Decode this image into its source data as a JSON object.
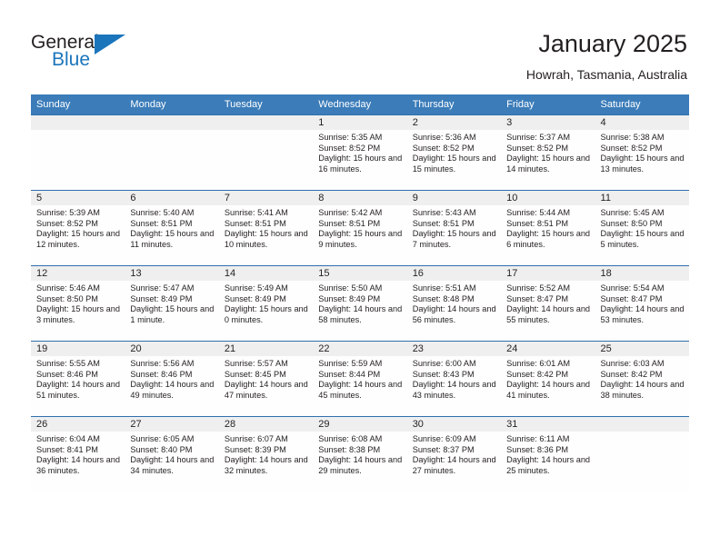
{
  "brand": {
    "name_part1": "General",
    "name_part2": "Blue",
    "accent_color": "#1b75bb"
  },
  "header": {
    "month_title": "January 2025",
    "location": "Howrah, Tasmania, Australia"
  },
  "calendar": {
    "header_bg": "#3b7cb9",
    "day_band_bg": "#efefef",
    "row_divider": "#2f6fad",
    "weekday_headers": [
      "Sunday",
      "Monday",
      "Tuesday",
      "Wednesday",
      "Thursday",
      "Friday",
      "Saturday"
    ],
    "weeks": [
      [
        {
          "day": "",
          "lines": []
        },
        {
          "day": "",
          "lines": []
        },
        {
          "day": "",
          "lines": []
        },
        {
          "day": "1",
          "lines": [
            "Sunrise: 5:35 AM",
            "Sunset: 8:52 PM",
            "Daylight: 15 hours and 16 minutes."
          ]
        },
        {
          "day": "2",
          "lines": [
            "Sunrise: 5:36 AM",
            "Sunset: 8:52 PM",
            "Daylight: 15 hours and 15 minutes."
          ]
        },
        {
          "day": "3",
          "lines": [
            "Sunrise: 5:37 AM",
            "Sunset: 8:52 PM",
            "Daylight: 15 hours and 14 minutes."
          ]
        },
        {
          "day": "4",
          "lines": [
            "Sunrise: 5:38 AM",
            "Sunset: 8:52 PM",
            "Daylight: 15 hours and 13 minutes."
          ]
        }
      ],
      [
        {
          "day": "5",
          "lines": [
            "Sunrise: 5:39 AM",
            "Sunset: 8:52 PM",
            "Daylight: 15 hours and 12 minutes."
          ]
        },
        {
          "day": "6",
          "lines": [
            "Sunrise: 5:40 AM",
            "Sunset: 8:51 PM",
            "Daylight: 15 hours and 11 minutes."
          ]
        },
        {
          "day": "7",
          "lines": [
            "Sunrise: 5:41 AM",
            "Sunset: 8:51 PM",
            "Daylight: 15 hours and 10 minutes."
          ]
        },
        {
          "day": "8",
          "lines": [
            "Sunrise: 5:42 AM",
            "Sunset: 8:51 PM",
            "Daylight: 15 hours and 9 minutes."
          ]
        },
        {
          "day": "9",
          "lines": [
            "Sunrise: 5:43 AM",
            "Sunset: 8:51 PM",
            "Daylight: 15 hours and 7 minutes."
          ]
        },
        {
          "day": "10",
          "lines": [
            "Sunrise: 5:44 AM",
            "Sunset: 8:51 PM",
            "Daylight: 15 hours and 6 minutes."
          ]
        },
        {
          "day": "11",
          "lines": [
            "Sunrise: 5:45 AM",
            "Sunset: 8:50 PM",
            "Daylight: 15 hours and 5 minutes."
          ]
        }
      ],
      [
        {
          "day": "12",
          "lines": [
            "Sunrise: 5:46 AM",
            "Sunset: 8:50 PM",
            "Daylight: 15 hours and 3 minutes."
          ]
        },
        {
          "day": "13",
          "lines": [
            "Sunrise: 5:47 AM",
            "Sunset: 8:49 PM",
            "Daylight: 15 hours and 1 minute."
          ]
        },
        {
          "day": "14",
          "lines": [
            "Sunrise: 5:49 AM",
            "Sunset: 8:49 PM",
            "Daylight: 15 hours and 0 minutes."
          ]
        },
        {
          "day": "15",
          "lines": [
            "Sunrise: 5:50 AM",
            "Sunset: 8:49 PM",
            "Daylight: 14 hours and 58 minutes."
          ]
        },
        {
          "day": "16",
          "lines": [
            "Sunrise: 5:51 AM",
            "Sunset: 8:48 PM",
            "Daylight: 14 hours and 56 minutes."
          ]
        },
        {
          "day": "17",
          "lines": [
            "Sunrise: 5:52 AM",
            "Sunset: 8:47 PM",
            "Daylight: 14 hours and 55 minutes."
          ]
        },
        {
          "day": "18",
          "lines": [
            "Sunrise: 5:54 AM",
            "Sunset: 8:47 PM",
            "Daylight: 14 hours and 53 minutes."
          ]
        }
      ],
      [
        {
          "day": "19",
          "lines": [
            "Sunrise: 5:55 AM",
            "Sunset: 8:46 PM",
            "Daylight: 14 hours and 51 minutes."
          ]
        },
        {
          "day": "20",
          "lines": [
            "Sunrise: 5:56 AM",
            "Sunset: 8:46 PM",
            "Daylight: 14 hours and 49 minutes."
          ]
        },
        {
          "day": "21",
          "lines": [
            "Sunrise: 5:57 AM",
            "Sunset: 8:45 PM",
            "Daylight: 14 hours and 47 minutes."
          ]
        },
        {
          "day": "22",
          "lines": [
            "Sunrise: 5:59 AM",
            "Sunset: 8:44 PM",
            "Daylight: 14 hours and 45 minutes."
          ]
        },
        {
          "day": "23",
          "lines": [
            "Sunrise: 6:00 AM",
            "Sunset: 8:43 PM",
            "Daylight: 14 hours and 43 minutes."
          ]
        },
        {
          "day": "24",
          "lines": [
            "Sunrise: 6:01 AM",
            "Sunset: 8:42 PM",
            "Daylight: 14 hours and 41 minutes."
          ]
        },
        {
          "day": "25",
          "lines": [
            "Sunrise: 6:03 AM",
            "Sunset: 8:42 PM",
            "Daylight: 14 hours and 38 minutes."
          ]
        }
      ],
      [
        {
          "day": "26",
          "lines": [
            "Sunrise: 6:04 AM",
            "Sunset: 8:41 PM",
            "Daylight: 14 hours and 36 minutes."
          ]
        },
        {
          "day": "27",
          "lines": [
            "Sunrise: 6:05 AM",
            "Sunset: 8:40 PM",
            "Daylight: 14 hours and 34 minutes."
          ]
        },
        {
          "day": "28",
          "lines": [
            "Sunrise: 6:07 AM",
            "Sunset: 8:39 PM",
            "Daylight: 14 hours and 32 minutes."
          ]
        },
        {
          "day": "29",
          "lines": [
            "Sunrise: 6:08 AM",
            "Sunset: 8:38 PM",
            "Daylight: 14 hours and 29 minutes."
          ]
        },
        {
          "day": "30",
          "lines": [
            "Sunrise: 6:09 AM",
            "Sunset: 8:37 PM",
            "Daylight: 14 hours and 27 minutes."
          ]
        },
        {
          "day": "31",
          "lines": [
            "Sunrise: 6:11 AM",
            "Sunset: 8:36 PM",
            "Daylight: 14 hours and 25 minutes."
          ]
        },
        {
          "day": "",
          "lines": []
        }
      ]
    ]
  }
}
